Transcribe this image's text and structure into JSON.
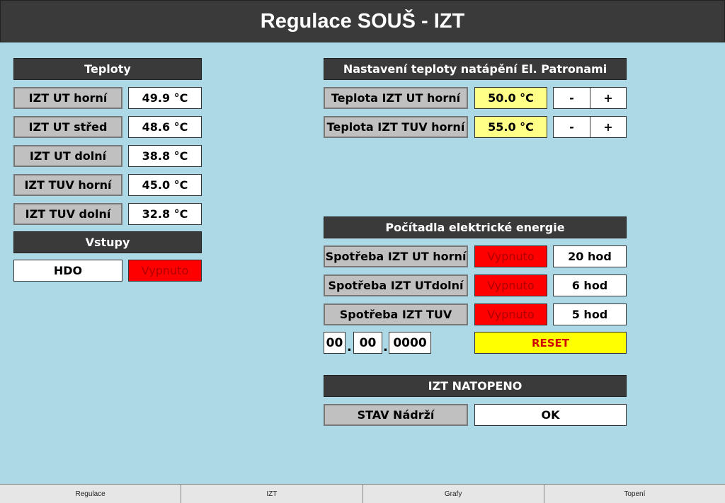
{
  "title": "Regulace SOUŠ - IZT",
  "teploty": {
    "header": "Teploty",
    "rows": [
      {
        "label": "IZT UT horní",
        "value": "49.9 °C"
      },
      {
        "label": "IZT UT střed",
        "value": "48.6 °C"
      },
      {
        "label": "IZT UT dolní",
        "value": "38.8 °C"
      },
      {
        "label": "IZT TUV horní",
        "value": "45.0 °C"
      },
      {
        "label": "IZT TUV dolní",
        "value": "32.8 °C"
      }
    ]
  },
  "vstupy": {
    "header": "Vstupy",
    "hdo_label": "HDO",
    "hdo_status": "Vypnuto"
  },
  "nastaveni": {
    "header": "Nastavení teploty natápění El. Patronami",
    "rows": [
      {
        "label": "Teplota IZT UT horní",
        "value": "50.0 °C",
        "minus": "-",
        "plus": "+"
      },
      {
        "label": "Teplota IZT TUV horní",
        "value": "55.0 °C",
        "minus": "-",
        "plus": "+"
      }
    ]
  },
  "pocitadla": {
    "header": "Počítadla elektrické energie",
    "rows": [
      {
        "label": "Spotřeba IZT UT horní",
        "status": "Vypnuto",
        "hours": "20 hod"
      },
      {
        "label": "Spotřeba IZT UTdolní",
        "status": "Vypnuto",
        "hours": "6 hod"
      },
      {
        "label": "Spotřeba IZT TUV",
        "status": "Vypnuto",
        "hours": "5 hod"
      }
    ],
    "date": {
      "day": "00",
      "month": "00",
      "year": "0000",
      "sep": "."
    },
    "reset_label": "RESET"
  },
  "natopeno": {
    "header": "IZT NATOPENO",
    "stav_label": "STAV Nádrží",
    "stav_value": "OK"
  },
  "tabs": [
    "Regulace",
    "IZT",
    "Grafy",
    "Topení"
  ],
  "colors": {
    "background": "#add8e6",
    "header": "#3a3a3a",
    "label": "#c0c0c0",
    "setpoint": "#ffff88",
    "status_off": "#ff0000",
    "reset": "#ffff00"
  }
}
